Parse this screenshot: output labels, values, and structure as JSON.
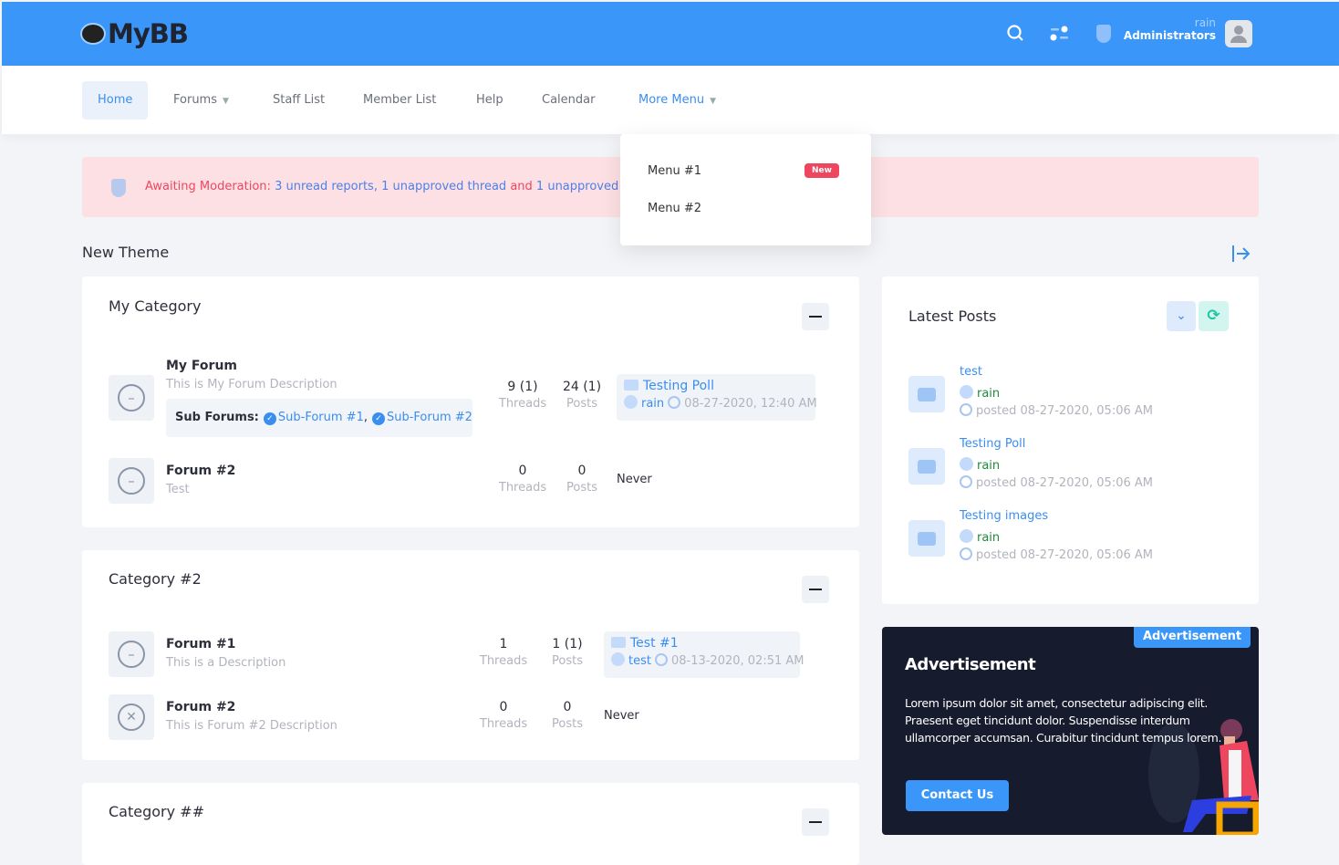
{
  "header": {
    "logo": "MyBB",
    "user_name": "rain",
    "user_group": "Administrators"
  },
  "nav": {
    "items": [
      {
        "label": "Home"
      },
      {
        "label": "Forums"
      },
      {
        "label": "Staff List"
      },
      {
        "label": "Member List"
      },
      {
        "label": "Help"
      },
      {
        "label": "Calendar"
      },
      {
        "label": "More Menu"
      }
    ]
  },
  "dropdown": {
    "items": [
      {
        "label": "Menu #1",
        "badge": "New"
      },
      {
        "label": "Menu #2"
      }
    ]
  },
  "alert": {
    "prefix": "Awaiting Moderation:",
    "reports": "3 unread reports,",
    "threads": "1 unapproved thread",
    "and": "and",
    "posts": "1 unapproved posts"
  },
  "section_title": "New Theme",
  "categories": [
    {
      "title": "My Category",
      "forums": [
        {
          "name": "My Forum",
          "desc": "This is My Forum Description",
          "subforums_label": "Sub Forums:",
          "subforums": [
            "Sub-Forum #1",
            "Sub-Forum #2"
          ],
          "threads": "9 (1)",
          "posts": "24 (1)",
          "threads_label": "Threads",
          "posts_label": "Posts",
          "last_title": "Testing Poll",
          "last_user": "rain",
          "last_date": "08-27-2020, 12:40 AM"
        },
        {
          "name": "Forum #2",
          "desc": "Test",
          "threads": "0",
          "posts": "0",
          "threads_label": "Threads",
          "posts_label": "Posts",
          "never": "Never"
        }
      ]
    },
    {
      "title": "Category #2",
      "forums": [
        {
          "name": "Forum #1",
          "desc": "This is a Description",
          "threads": "1",
          "posts": "1 (1)",
          "threads_label": "Threads",
          "posts_label": "Posts",
          "last_title": "Test #1",
          "last_user": "test",
          "last_date": "08-13-2020, 02:51 AM"
        },
        {
          "name": "Forum #2",
          "desc": "This is Forum #2 Description",
          "threads": "0",
          "posts": "0",
          "threads_label": "Threads",
          "posts_label": "Posts",
          "never": "Never"
        }
      ]
    },
    {
      "title": "Category ##"
    }
  ],
  "latest": {
    "title": "Latest Posts",
    "posts": [
      {
        "title": "test",
        "user": "rain",
        "date": "posted 08-27-2020, 05:06 AM"
      },
      {
        "title": "Testing Poll",
        "user": "rain",
        "date": "posted 08-27-2020, 05:06 AM"
      },
      {
        "title": "Testing images",
        "user": "rain",
        "date": "posted 08-27-2020, 05:06 AM"
      }
    ]
  },
  "ad": {
    "tag": "Advertisement",
    "title": "Advertisement",
    "body": "Lorem ipsum dolor sit amet, consectetur adipiscing elit. Praesent eget tincidunt dolor. Suspendisse interdum ullamcorper accumsan. Curabitur tincidunt tempus lorem.",
    "button": "Contact Us"
  }
}
